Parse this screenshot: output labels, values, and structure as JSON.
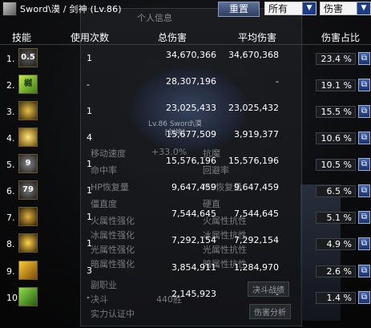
{
  "window": {
    "title": "Sword\\漠 / 剑神 (Lv.86)",
    "reset_label": "重置",
    "filter1": "所有",
    "filter2": "伤害"
  },
  "background_panel": {
    "title": "个人信息",
    "char_name": "Lv.86 Sword\\漠",
    "char_class": "[剑神]",
    "stats": [
      "移动速度",
      "+33.0%",
      "抗魔",
      "命中率",
      "回避率",
      "HP恢复量",
      "MP恢复量",
      "僵直度",
      "硬直",
      "火属性强化",
      "火属性抗性",
      "冰属性强化",
      "冰属性抗性",
      "光属性强化",
      "光属性抗性",
      "暗属性强化",
      "暗属性抗性",
      "副职业",
      "决斗",
      "440胜",
      "实力认证中",
      "决斗战绩",
      "伤害分析"
    ]
  },
  "headers": {
    "skill": "技能",
    "count": "使用次数",
    "total": "总伤害",
    "average": "平均伤害",
    "percent": "伤害占比"
  },
  "detail_icon": "window-icon",
  "rows": [
    {
      "rank": "1.",
      "skill_label": "0.5",
      "count": "1",
      "total": "34,670,366",
      "average": "34,670,368",
      "percent": "23.4 %"
    },
    {
      "rank": "2.",
      "skill_label": "樾",
      "count": "-",
      "total": "28,307,196",
      "average": "-",
      "percent": "19.1 %"
    },
    {
      "rank": "3.",
      "skill_label": "",
      "count": "1",
      "total": "23,025,433",
      "average": "23,025,432",
      "percent": "15.5 %"
    },
    {
      "rank": "4.",
      "skill_label": "",
      "count": "4",
      "total": "15,677,509",
      "average": "3,919,377",
      "percent": "10.6 %"
    },
    {
      "rank": "5.",
      "skill_label": "9",
      "count": "1",
      "total": "15,576,196",
      "average": "15,576,196",
      "percent": "10.5 %"
    },
    {
      "rank": "6.",
      "skill_label": "79",
      "count": "1",
      "total": "9,647,459",
      "average": "9,647,459",
      "percent": "6.5 %"
    },
    {
      "rank": "7.",
      "skill_label": "",
      "count": "1",
      "total": "7,544,645",
      "average": "7,544,645",
      "percent": "5.1 %"
    },
    {
      "rank": "8.",
      "skill_label": "",
      "count": "1",
      "total": "7,292,154",
      "average": "7,292,154",
      "percent": "4.9 %"
    },
    {
      "rank": "9.",
      "skill_label": "",
      "count": "3",
      "total": "3,854,911",
      "average": "1,284,970",
      "percent": "2.6 %"
    },
    {
      "rank": "10.",
      "skill_label": "",
      "count": "-",
      "total": "2,145,923",
      "average": "-",
      "percent": "1.4 %"
    }
  ]
}
